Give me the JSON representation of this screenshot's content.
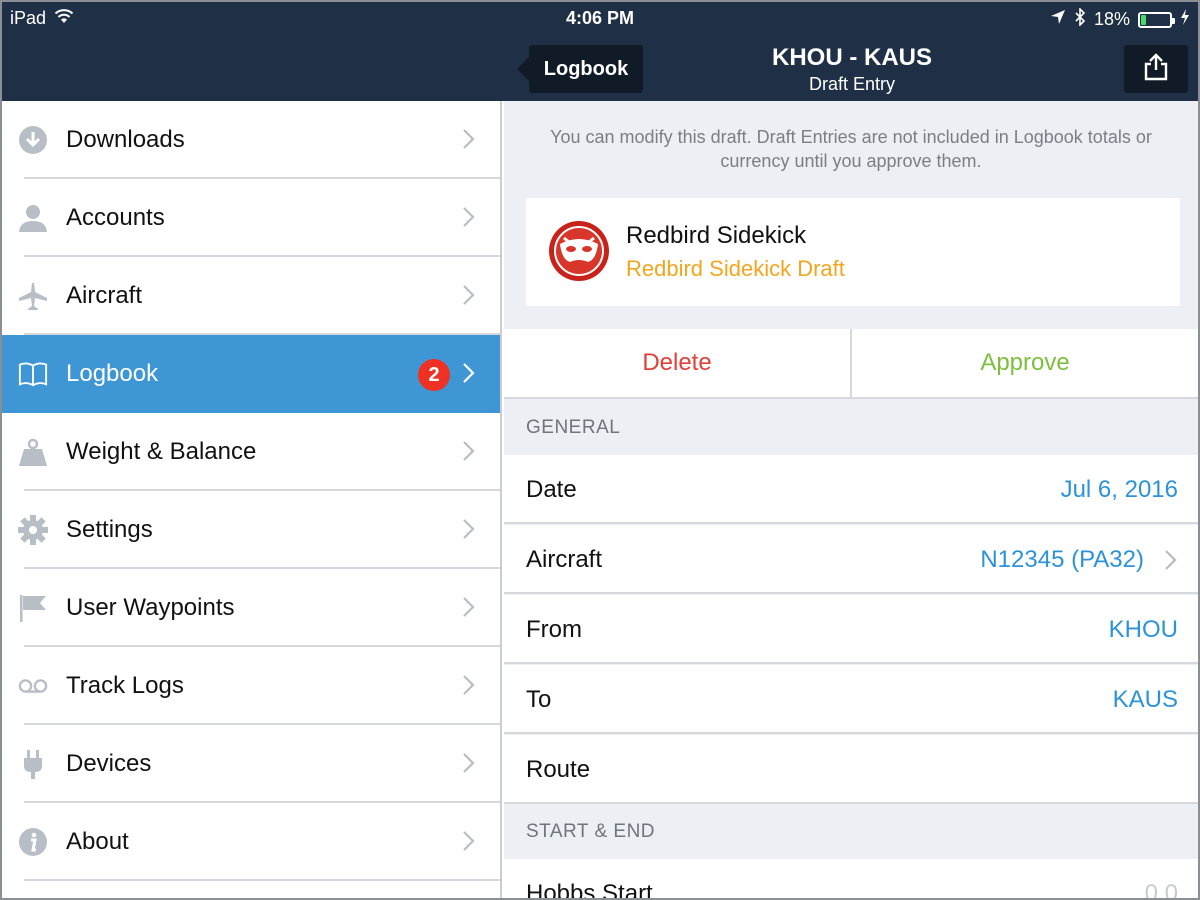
{
  "status": {
    "device": "iPad",
    "time": "4:06 PM",
    "battery_text": "18%",
    "battery_level": 0.18
  },
  "nav": {
    "back_label": "Logbook",
    "title": "KHOU - KAUS",
    "subtitle": "Draft Entry"
  },
  "sidebar": {
    "items": [
      {
        "label": "Downloads",
        "icon": "download-icon"
      },
      {
        "label": "Accounts",
        "icon": "person-icon"
      },
      {
        "label": "Aircraft",
        "icon": "airplane-icon"
      },
      {
        "label": "Logbook",
        "icon": "book-icon",
        "badge": "2",
        "active": true
      },
      {
        "label": "Weight & Balance",
        "icon": "weight-icon"
      },
      {
        "label": "Settings",
        "icon": "gear-icon"
      },
      {
        "label": "User Waypoints",
        "icon": "flag-icon"
      },
      {
        "label": "Track Logs",
        "icon": "tape-icon"
      },
      {
        "label": "Devices",
        "icon": "plug-icon"
      },
      {
        "label": "About",
        "icon": "info-icon"
      }
    ]
  },
  "detail": {
    "notice": "You can modify this draft. Draft Entries are not included in Logbook totals or currency until you approve them.",
    "card": {
      "name": "Redbird Sidekick",
      "subtitle": "Redbird Sidekick Draft"
    },
    "actions": {
      "delete": "Delete",
      "approve": "Approve"
    },
    "general_header": "GENERAL",
    "general_rows": [
      {
        "key": "Date",
        "value": "Jul 6, 2016"
      },
      {
        "key": "Aircraft",
        "value": "N12345 (PA32)"
      },
      {
        "key": "From",
        "value": "KHOU"
      },
      {
        "key": "To",
        "value": "KAUS"
      },
      {
        "key": "Route",
        "value": ""
      }
    ],
    "start_end_header": "START & END",
    "start_end_rows": [
      {
        "key": "Hobbs Start",
        "value": "0.0"
      }
    ]
  },
  "colors": {
    "navy": "#1f3046",
    "active_blue": "#3f96d5",
    "value_blue": "#2d93d8",
    "delete_red": "#e0413b",
    "approve_green": "#7fbf3f",
    "draft_orange": "#f2a61e",
    "badge_red": "#ef3124"
  }
}
